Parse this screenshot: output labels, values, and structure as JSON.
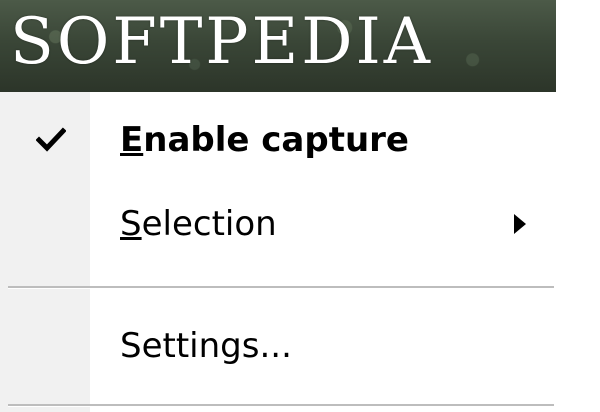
{
  "banner": {
    "logo_text": "SOFTPEDIA"
  },
  "menu": {
    "items": [
      {
        "mnemonic": "E",
        "rest": "nable capture",
        "checked": true,
        "bold": true,
        "icon": "check-icon"
      },
      {
        "mnemonic": "S",
        "rest": "election",
        "has_submenu": true,
        "icon": "submenu-arrow-icon"
      },
      {
        "label": "Settings..."
      }
    ]
  },
  "colors": {
    "gutter": "#f1f1f1",
    "separator": "#bdbdbd",
    "text": "#000000"
  }
}
